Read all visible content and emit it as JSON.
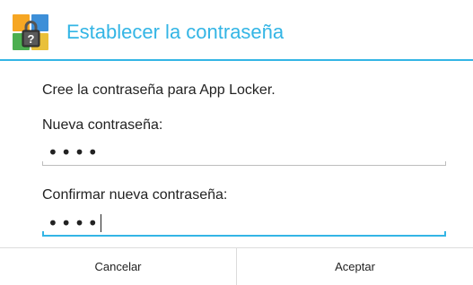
{
  "dialog": {
    "title": "Establecer la contraseña",
    "title_icon": "app-locker-lock-icon",
    "message": "Cree la contraseña para App Locker."
  },
  "fields": {
    "new_password": {
      "label": "Nueva contraseña:",
      "masked_value": "••••",
      "focused": false
    },
    "confirm_password": {
      "label": "Confirmar nueva contraseña:",
      "masked_value": "••••",
      "focused": true
    }
  },
  "buttons": {
    "cancel_label": "Cancelar",
    "accept_label": "Aceptar"
  },
  "colors": {
    "accent": "#33b5e5",
    "text": "#222222",
    "divider": "#dcdcdc"
  }
}
